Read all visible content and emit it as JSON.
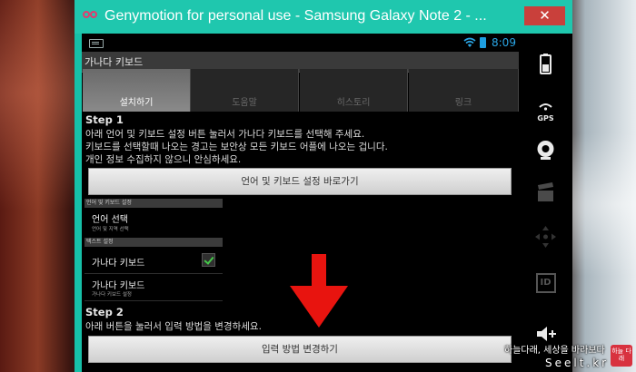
{
  "window": {
    "title": "Genymotion for personal use - Samsung Galaxy Note 2 - ...",
    "close_glyph": "✕"
  },
  "status_bar": {
    "time": "8:09",
    "icons": [
      "keyboard-icon",
      "wifi-icon",
      "battery-icon"
    ],
    "accent": "#2aa6e6"
  },
  "app": {
    "title": "가나다 키보드",
    "tabs": [
      {
        "label": "설치하기",
        "active": true
      },
      {
        "label": "도움말",
        "active": false
      },
      {
        "label": "히스토리",
        "active": false
      },
      {
        "label": "링크",
        "active": false
      }
    ],
    "step1": {
      "heading": "Step 1",
      "lines": [
        "아래 언어 및 키보드 설정 버튼 눌러서 가나다 키보드를 선택해 주세요.",
        "키보드를 선택할때 나오는 경고는 보안상 모든 키보드 어플에 나오는 겁니다.",
        "개인 정보 수집하지 않으니 안심하세요."
      ],
      "button": "언어 및 키보드 설정 바로가기"
    },
    "settings": {
      "section1": "언어 및 키보드 설정",
      "lang_title": "언어 선택",
      "lang_sub": "언어 및 지역 선택",
      "section2": "텍스트 설정",
      "kbd_item": "가나다 키보드",
      "kbd_checked": true,
      "kbd_settings_title": "가나다 키보드",
      "kbd_settings_sub": "가나다 키보드 설정"
    },
    "step2": {
      "heading": "Step 2",
      "line": "아래 버튼을 눌러서 입력 방법을 변경하세요.",
      "button": "입력 방법 변경하기"
    }
  },
  "sidebar": {
    "items": [
      "battery-icon",
      "gps-icon",
      "camera-icon",
      "clapper-icon",
      "dpad-icon",
      "id-icon",
      "volume-up-icon"
    ],
    "gps_label": "GPS",
    "id_label": "ID"
  },
  "watermark": {
    "line1": "하늘다래, 세상을 바라보다",
    "line2": "Seelt.kr",
    "badge": "하늘 다래"
  },
  "colors": {
    "title_bar": "#1fc7ae",
    "close": "#c9403b",
    "arrow": "#e8140f",
    "check": "#45c94a"
  }
}
